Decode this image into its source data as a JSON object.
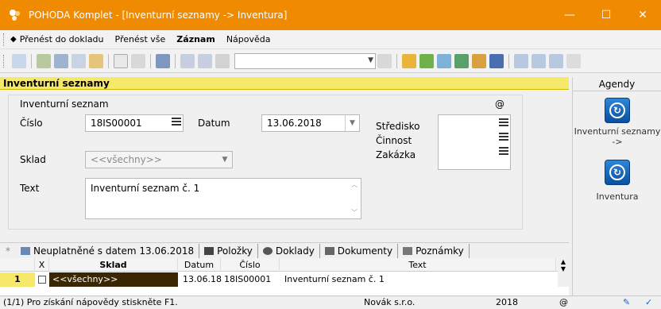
{
  "window": {
    "title": "POHODA Komplet - [Inventurní seznamy -> Inventura]",
    "controls": [
      "—",
      "☐",
      "✕"
    ]
  },
  "menu": {
    "items": [
      {
        "label": "Přenést do dokladu",
        "bold": false
      },
      {
        "label": "Přenést vše",
        "bold": false
      },
      {
        "label": "Záznam",
        "bold": true
      },
      {
        "label": "Nápověda",
        "bold": false
      }
    ]
  },
  "section": {
    "title": "Inventurní seznamy"
  },
  "form": {
    "group_label": "Inventurní seznam",
    "at_symbol": "@",
    "cislo_label": "Číslo",
    "cislo_value": "18IS00001",
    "datum_label": "Datum",
    "datum_value": "13.06.2018",
    "sklad_label": "Sklad",
    "sklad_value": "<<všechny>>",
    "text_label": "Text",
    "text_value": "Inventurní seznam č. 1",
    "stredisko_label": "Středisko",
    "cinnost_label": "Činnost",
    "zakazka_label": "Zakázka"
  },
  "agenda": {
    "header": "Agendy",
    "items": [
      {
        "label": "Inventurní seznamy ->",
        "icon": "pohoda-agenda-icon"
      },
      {
        "label": "Inventura",
        "icon": "pohoda-agenda-icon"
      }
    ]
  },
  "tabs": [
    {
      "label": "Neuplatněné s datem 13.06.2018",
      "icon": "filter-icon"
    },
    {
      "label": "Položky",
      "icon": "list-icon"
    },
    {
      "label": "Doklady",
      "icon": "doc-icon"
    },
    {
      "label": "Dokumenty",
      "icon": "folder-icon"
    },
    {
      "label": "Poznámky",
      "icon": "note-icon"
    }
  ],
  "grid": {
    "star": "*",
    "columns": [
      "X",
      "Sklad",
      "Datum",
      "Číslo",
      "Text"
    ],
    "rows": [
      {
        "num": "1",
        "sklad": "<<všechny>>",
        "datum": "13.06.18",
        "cislo": "18IS00001",
        "text": "Inventurní seznam č. 1"
      }
    ]
  },
  "status": {
    "help": "(1/1) Pro získání nápovědy stiskněte F1.",
    "company": "Novák s.r.o.",
    "year": "2018",
    "at": "@"
  },
  "colors": {
    "titlebar": "#f08a00",
    "section": "#f6e96a",
    "row_highlight": "#3a2600"
  }
}
